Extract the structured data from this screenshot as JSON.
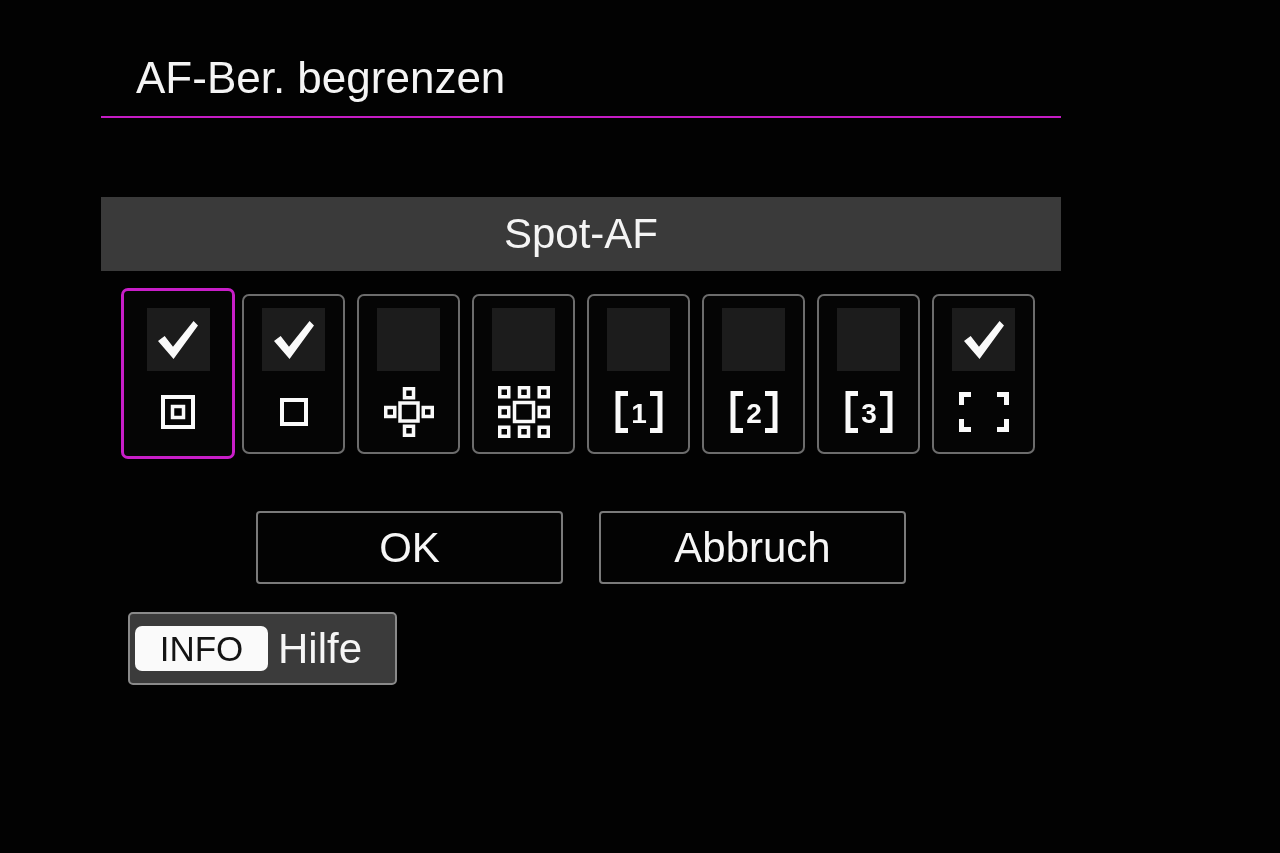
{
  "title": "AF-Ber. begrenzen",
  "current_mode": "Spot-AF",
  "af_modes": [
    {
      "kind": "spot",
      "checked": true,
      "selected": true
    },
    {
      "kind": "single-point",
      "checked": true,
      "selected": false
    },
    {
      "kind": "expand-cross",
      "checked": false,
      "selected": false
    },
    {
      "kind": "expand-around",
      "checked": false,
      "selected": false
    },
    {
      "kind": "zone",
      "label": "1",
      "checked": false,
      "selected": false
    },
    {
      "kind": "zone",
      "label": "2",
      "checked": false,
      "selected": false
    },
    {
      "kind": "zone",
      "label": "3",
      "checked": false,
      "selected": false
    },
    {
      "kind": "whole-area",
      "checked": true,
      "selected": false
    }
  ],
  "buttons": [
    "OK",
    "Abbruch"
  ],
  "help": {
    "key": "INFO",
    "label": "Hilfe"
  }
}
